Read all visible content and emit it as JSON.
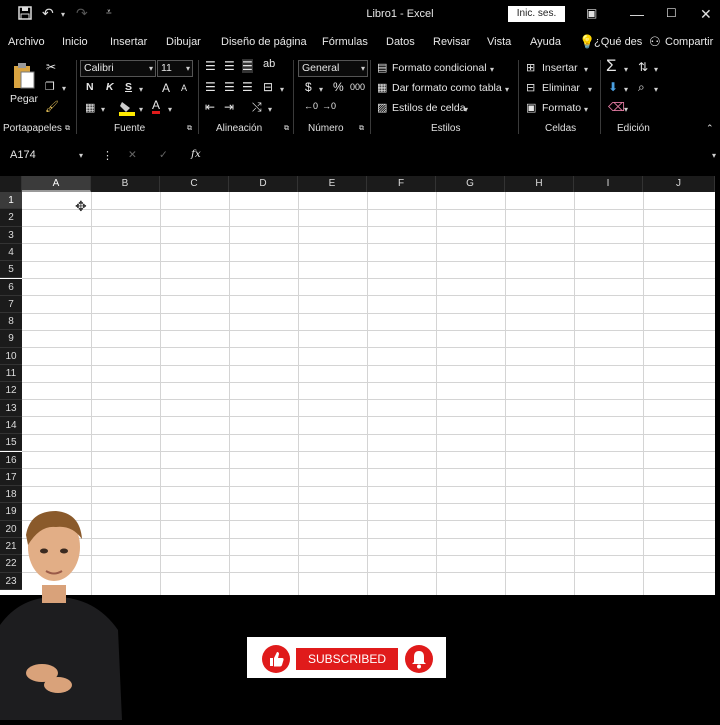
{
  "titlebar": {
    "title": "Libro1  -  Excel",
    "signin": "Inic. ses."
  },
  "menu": [
    "Archivo",
    "Inicio",
    "Insertar",
    "Dibujar",
    "Diseño de página",
    "Fórmulas",
    "Datos",
    "Revisar",
    "Vista",
    "Ayuda",
    "¿Qué des",
    "Compartir"
  ],
  "ribbon": {
    "paste_label": "Pegar",
    "font_name": "Calibri",
    "font_size": "11",
    "bold": "N",
    "italic": "K",
    "underline": "S",
    "grow_font": "A",
    "shrink_font": "A",
    "font_color": "A",
    "number_format": "General",
    "currency": "$",
    "percent": "%",
    "thousands": "000",
    "dec_increase": "←0",
    "dec_decrease": "→0",
    "cond_format": "Formato condicional",
    "format_table": "Dar formato como tabla",
    "cell_styles": "Estilos de celda",
    "insert": "Insertar",
    "delete": "Eliminar",
    "format": "Formato",
    "sum": "Σ",
    "groups": [
      "Portapapeles",
      "Fuente",
      "Alineación",
      "Número",
      "Estilos",
      "Celdas",
      "Edición"
    ]
  },
  "formula_bar": {
    "name_box": "A174",
    "cancel": "✕",
    "enter": "✓",
    "fx": "fx",
    "value": ""
  },
  "sheet": {
    "columns": [
      "A",
      "B",
      "C",
      "D",
      "E",
      "F",
      "G",
      "H",
      "I",
      "J"
    ],
    "rows": [
      "1",
      "2",
      "3",
      "4",
      "5",
      "6",
      "7",
      "8",
      "9",
      "10",
      "11",
      "12",
      "13",
      "14",
      "15",
      "16",
      "17",
      "18",
      "19",
      "20",
      "21",
      "22",
      "23"
    ],
    "selected_column": "A"
  },
  "overlay": {
    "subscribe_label": "SUBSCRIBED"
  },
  "colors": {
    "background": "#000000",
    "accent_red": "#e01b1b",
    "grid": "#ffffff"
  }
}
